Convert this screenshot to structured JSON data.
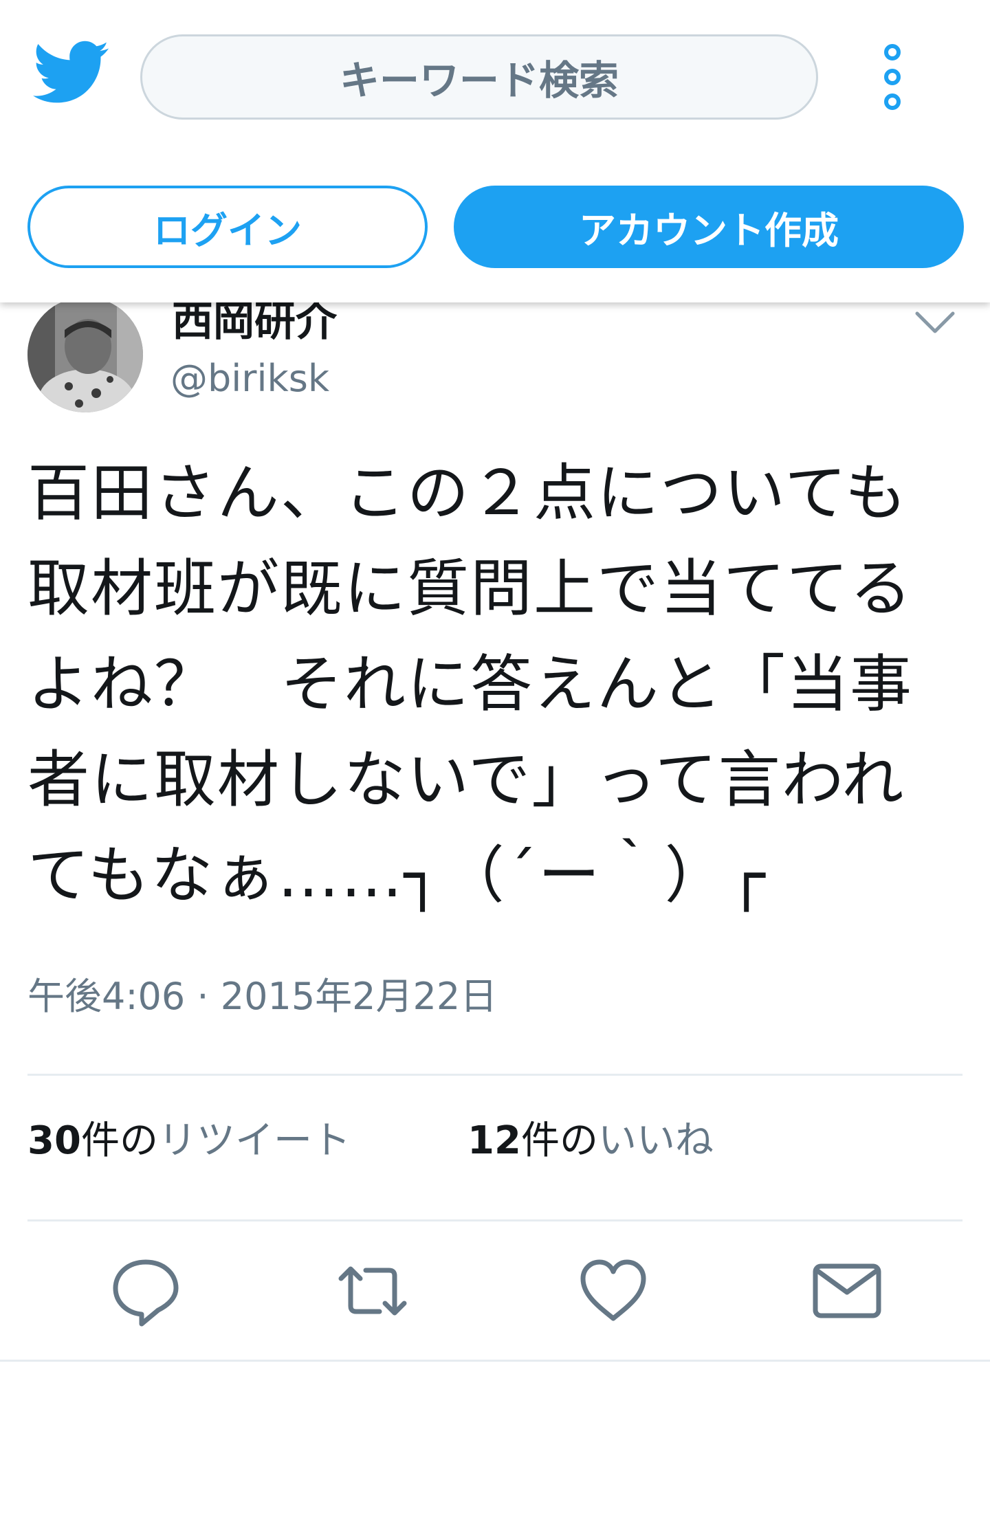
{
  "header": {
    "search_placeholder": "キーワード検索",
    "login_label": "ログイン",
    "signup_label": "アカウント作成"
  },
  "tweet": {
    "author_name": "西岡研介",
    "author_handle": "@biriksk",
    "text": "百田さん、この２点についても\n取材班が既に質問上で当ててる\nよね？　それに答えんと「当事\n者に取材しないで」って言われ\nてもなぁ……┐（´ー｀）┌",
    "timestamp": "午後4:06 · 2015年2月22日",
    "retweets": {
      "count": "30",
      "unit": "件の",
      "label": "リツイート"
    },
    "likes": {
      "count": "12",
      "unit": "件の",
      "label": "いいね"
    }
  },
  "actions": [
    "reply-icon",
    "retweet-icon",
    "like-icon",
    "direct-message-icon"
  ],
  "colors": {
    "brand_blue": "#1da1f2",
    "secondary_text": "#657786",
    "primary_text": "#14171a",
    "divider": "#e6ecf0"
  }
}
